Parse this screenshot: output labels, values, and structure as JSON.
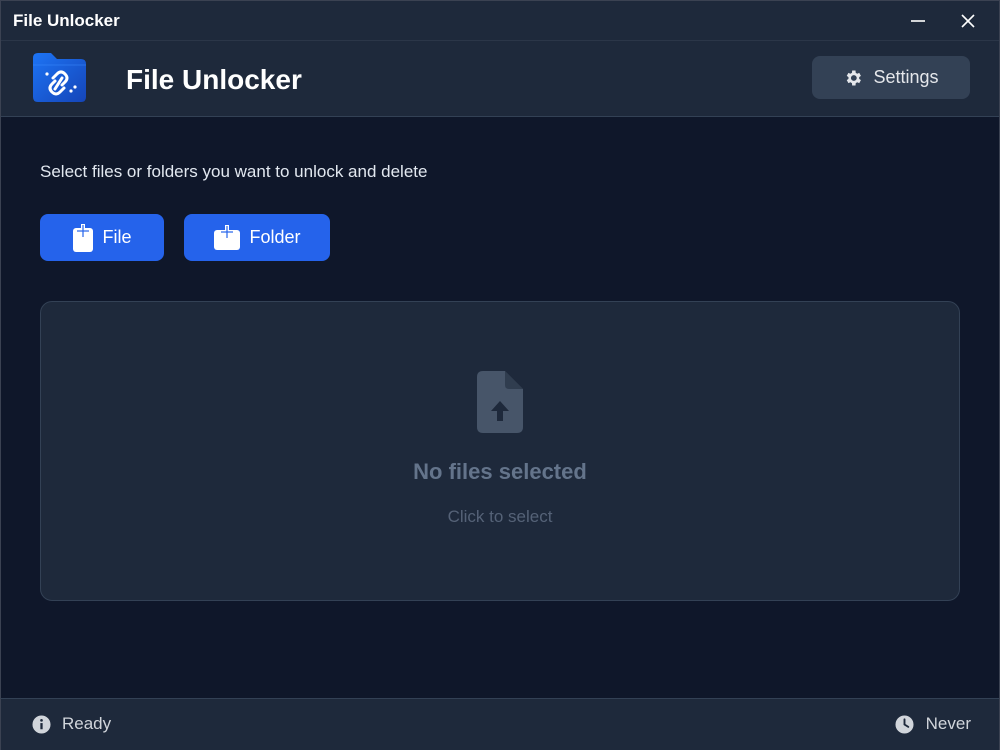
{
  "window": {
    "title": "File Unlocker"
  },
  "header": {
    "app_title": "File Unlocker",
    "settings_label": "Settings"
  },
  "main": {
    "instruction": "Select files or folders you want to unlock and delete",
    "file_button_label": "File",
    "folder_button_label": "Folder",
    "dropzone": {
      "title": "No files selected",
      "subtitle": "Click to select"
    }
  },
  "status": {
    "left_text": "Ready",
    "right_text": "Never"
  },
  "colors": {
    "background": "#0f172a",
    "panel": "#1e293b",
    "accent": "#2563eb",
    "muted": "#64748b"
  },
  "icons": {
    "logo": "folder-link-icon",
    "settings": "gear-icon",
    "file_add": "file-plus-icon",
    "folder_add": "folder-plus-icon",
    "upload": "file-upload-icon",
    "status_info": "info-icon",
    "status_time": "clock-icon"
  }
}
